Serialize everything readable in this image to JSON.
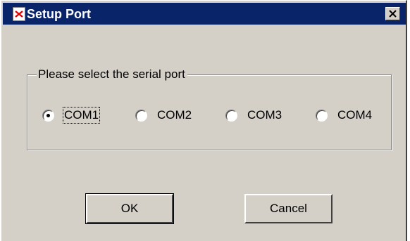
{
  "window": {
    "title": "Setup Port",
    "icon": "broken-image-icon",
    "close_icon": "close-icon",
    "colors": {
      "titlebar": "#0a246a",
      "face": "#d4d0c8"
    }
  },
  "group": {
    "label": "Please select the serial port"
  },
  "ports": [
    {
      "label": "COM1",
      "selected": true
    },
    {
      "label": "COM2",
      "selected": false
    },
    {
      "label": "COM3",
      "selected": false
    },
    {
      "label": "COM4",
      "selected": false
    }
  ],
  "buttons": {
    "ok": "OK",
    "cancel": "Cancel"
  }
}
